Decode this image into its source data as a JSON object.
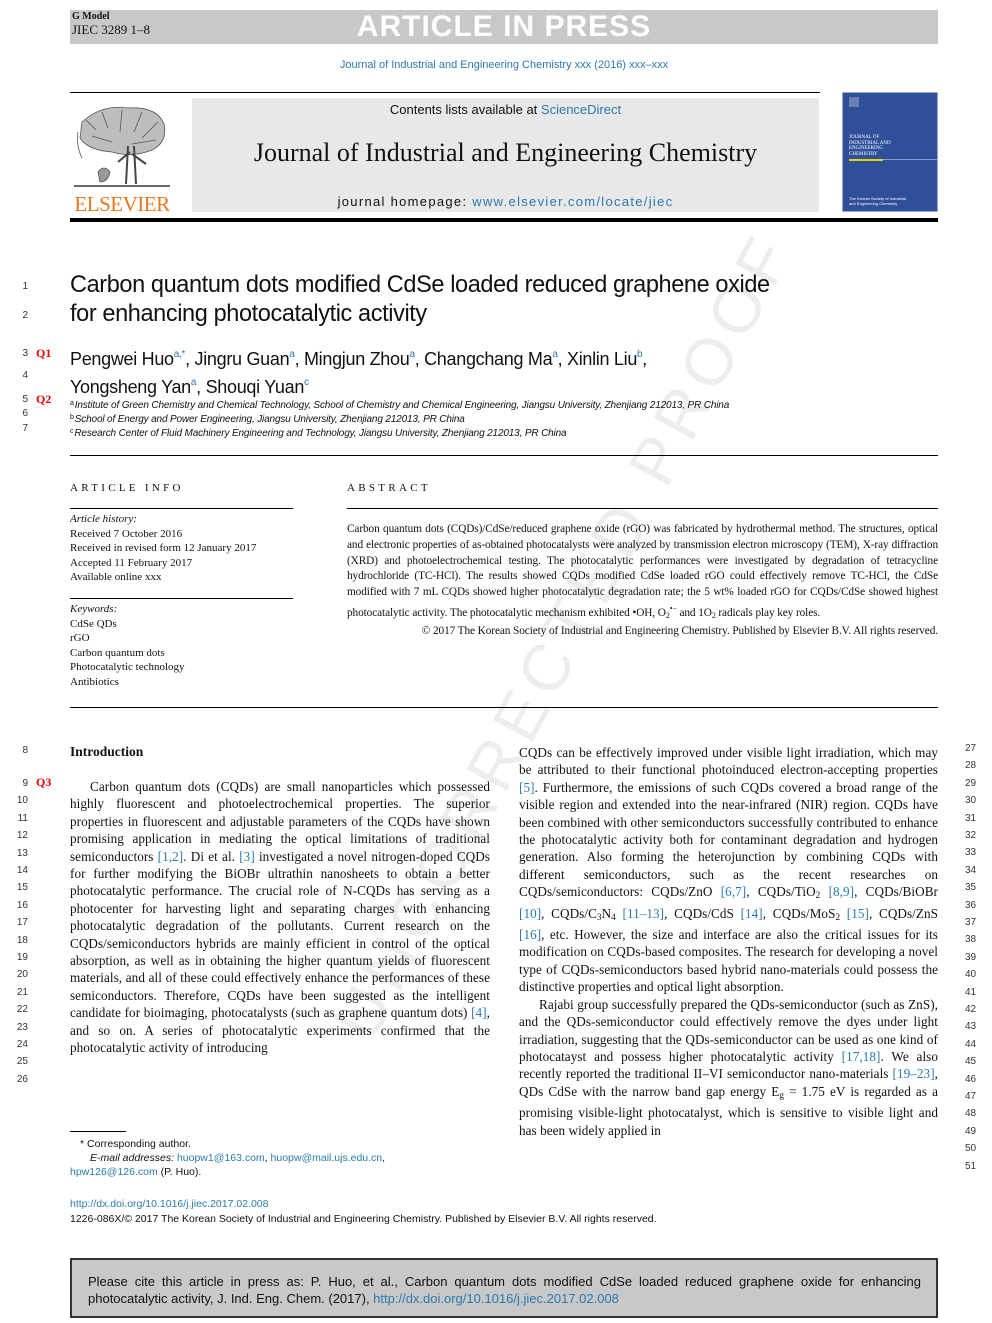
{
  "banner": {
    "g_model": "G Model",
    "jiec_id": "JIEC 3289 1–8",
    "status": "ARTICLE IN PRESS"
  },
  "journal_ref": "Journal of Industrial and Engineering Chemistry xxx (2016) xxx–xxx",
  "masthead": {
    "publisher_logo_text": "ELSEVIER",
    "contents_prefix": "Contents lists available at ",
    "contents_link": "ScienceDirect",
    "journal_title": "Journal of Industrial and Engineering Chemistry",
    "homepage_prefix": "journal homepage: ",
    "homepage_link": "www.elsevier.com/locate/jiec",
    "cover_title_lines": [
      "Journal of",
      "Industrial and",
      "Engineering",
      "Chemistry"
    ],
    "cover_publisher_lines": [
      "The Korean Society of Industrial",
      "and Engineering Chemistry"
    ]
  },
  "title_lines": [
    "Carbon quantum dots modified CdSe loaded reduced graphene oxide",
    "for enhancing photocatalytic activity"
  ],
  "authors": [
    {
      "name": "Pengwei Huo",
      "aff": "a,*",
      "sep": ", "
    },
    {
      "name": "Jingru Guan",
      "aff": "a",
      "sep": ", "
    },
    {
      "name": "Mingjun Zhou",
      "aff": "a",
      "sep": ", "
    },
    {
      "name": "Changchang Ma",
      "aff": "a",
      "sep": ", "
    },
    {
      "name": "Xinlin Liu",
      "aff": "b",
      "sep": ","
    },
    {
      "name": "Yongsheng Yan",
      "aff": "a",
      "sep": ", "
    },
    {
      "name": "Shouqi Yuan",
      "aff": "c",
      "sep": ""
    }
  ],
  "affiliations": [
    {
      "key": "a",
      "text": "Institute of Green Chemistry and Chemical Technology, School of Chemistry and Chemical Engineering, Jiangsu University, Zhenjiang 212013, PR China"
    },
    {
      "key": "b",
      "text": "School of Energy and Power Engineering, Jiangsu University, Zhenjiang 212013, PR China"
    },
    {
      "key": "c",
      "text": "Research Center of Fluid Machinery Engineering and Technology, Jiangsu University, Zhenjiang 212013, PR China"
    }
  ],
  "query_marks": [
    "Q1",
    "Q2",
    "Q3"
  ],
  "article_info": {
    "heading": "ARTICLE INFO",
    "history_label": "Article history:",
    "history": [
      "Received 7 October 2016",
      "Received in revised form 12 January 2017",
      "Accepted 11 February 2017",
      "Available online xxx"
    ],
    "keywords_label": "Keywords:",
    "keywords": [
      "CdSe QDs",
      "rGO",
      "Carbon quantum dots",
      "Photocatalytic technology",
      "Antibiotics"
    ]
  },
  "abstract": {
    "heading": "ABSTRACT",
    "body_1": "Carbon quantum dots (CQDs)/CdSe/reduced graphene oxide (rGO) was fabricated by hydrothermal method. The structures, optical and electronic properties of as-obtained photocatalysts were analyzed by transmission electron microscopy (TEM), X-ray diffraction (XRD) and photoelectrochemical testing. The photocatalytic performances were investigated by degradation of tetracycline hydrochloride (TC-HCl). The results showed CQDs modified CdSe loaded rGO could effectively remove TC-HCl, the CdSe modified with 7 mL CQDs showed higher photocatalytic degradation rate; the 5 wt% loaded rGO for CQDs/CdSe showed highest photocatalytic activity. The photocatalytic mechanism exhibited ",
    "radical_oh": "•OH, O",
    "radical_o2_sub": "2",
    "radical_o2_sup": "•−",
    "and_text": " and 1O",
    "singlet_sub": "2",
    "body_end": " radicals play key roles.",
    "copyright": "© 2017 The Korean Society of Industrial and Engineering Chemistry. Published by Elsevier B.V. All rights reserved."
  },
  "intro": {
    "heading": "Introduction",
    "left_p1": [
      "Carbon quantum dots (CQDs) are small nanoparticles which possessed highly fluorescent and photoelectrochemical properties. The superior properties in fluorescent and adjustable parameters of the CQDs have shown promising application in mediating the optical limitations of traditional semiconductors ",
      "[1,2]",
      ". Di et al. ",
      "[3]",
      " investigated a novel nitrogen-doped CQDs for further modifying the BiOBr ultrathin nanosheets to obtain a better photocatalytic performance. The crucial role of N-CQDs has serving as a photocenter for harvesting light and separating charges with enhancing photocatalytic degradation of the pollutants. Current research on the CQDs/semiconductors hybrids are mainly efficient in control of the optical absorption, as well as in obtaining the higher quantum yields of fluorescent materials, and all of these could effectively enhance the performances of these semiconductors. Therefore, CQDs have been suggested as the intelligent candidate for bioimaging, photocatalysts (such as graphene quantum dots) ",
      "[4]",
      ", and so on. A series of photocatalytic experiments confirmed that the photocatalytic activity of introducing"
    ],
    "right_p1": {
      "t1": "CQDs can be effectively improved under visible light irradiation, which may be attributed to their functional photoinduced electron-accepting properties ",
      "r5": "[5]",
      "t2": ". Furthermore, the emissions of such CQDs covered a broad range of the visible region and extended into the near-infrared (NIR) region. CQDs have been combined with other semiconductors successfully contributed to enhance the photocatalytic activity both for contaminant degradation and hydrogen generation. Also forming the heterojunction by combining CQDs with different semiconductors, such as the recent researches on CQDs/semiconductors: CQDs/ZnO ",
      "r67": "[6,7]",
      "t3": ", CQDs/TiO",
      "s1": "2",
      "r89": "[8,9]",
      "t4": ", CQDs/BiOBr ",
      "r10": "[10]",
      "t5": ", CQDs/C",
      "s2": "3",
      "t5b": "N",
      "s3": "4",
      "r1113": "[11–13]",
      "t6": ", CQDs/CdS ",
      "r14": "[14]",
      "t7": ", CQDs/MoS",
      "s4": "2",
      "r15": "[15]",
      "t8": ", CQDs/ZnS ",
      "r16": "[16]",
      "t9": ", etc. However, the size and interface are also the critical issues for its modification on CQDs-based composites. The research for developing a novel type of CQDs-semiconductors based hybrid nano-materials could possess the distinctive properties and optical light absorption."
    },
    "right_p2": {
      "t1": "Rajabi group successfully prepared the QDs-semiconductor (such as ZnS), and the QDs-semiconductor could effectively remove the dyes under light irradiation, suggesting that the QDs-semiconductor can be used as one kind of photocatayst and possess higher photocatalytic activity ",
      "r1718": "[17,18]",
      "t2": ". We also recently reported the traditional II–VI semiconductor nano-materials ",
      "r1923": "[19–23]",
      "t3": ", QDs CdSe with the narrow band gap energy E",
      "sub_g": "g",
      "t4": " = 1.75 eV is regarded as a promising visible-light photocatalyst, which is sensitive to visible light and has been widely applied in"
    }
  },
  "line_numbers": {
    "header": [
      "1",
      "2",
      "3",
      "4",
      "5",
      "6",
      "7"
    ],
    "left": [
      "8",
      "9",
      "10",
      "11",
      "12",
      "13",
      "14",
      "15",
      "16",
      "17",
      "18",
      "19",
      "20",
      "21",
      "22",
      "23",
      "24",
      "25",
      "26"
    ],
    "right": [
      "27",
      "28",
      "29",
      "30",
      "31",
      "32",
      "33",
      "34",
      "35",
      "36",
      "37",
      "38",
      "39",
      "40",
      "41",
      "42",
      "43",
      "44",
      "45",
      "46",
      "47",
      "48",
      "49",
      "50",
      "51"
    ]
  },
  "footnote": {
    "star": "*",
    "corresponding": "Corresponding author.",
    "email_label": "E-mail addresses:",
    "emails": [
      "huopw1@163.com",
      "huopw@mail.ujs.edu.cn",
      "hpw126@126.com"
    ],
    "owner": " (P. Huo)."
  },
  "doi": "http://dx.doi.org/10.1016/j.jiec.2017.02.008",
  "issn_copyright": "1226-086X/© 2017 The Korean Society of Industrial and Engineering Chemistry. Published by Elsevier B.V. All rights reserved.",
  "cite_box": {
    "text": "Please cite this article in press as: P. Huo, et al., Carbon quantum dots modified CdSe loaded reduced graphene oxide for enhancing photocatalytic activity, J. Ind. Eng. Chem. (2017), ",
    "link": "http://dx.doi.org/10.1016/j.jiec.2017.02.008"
  },
  "watermark": "UNCORRECTED PROOF",
  "colors": {
    "link": "#2a7ab0",
    "banner_bg": "#c8c8c8",
    "elsevier_orange": "#e87722",
    "query_red": "#ee0000",
    "cover_blue": "#2f4f9a"
  }
}
